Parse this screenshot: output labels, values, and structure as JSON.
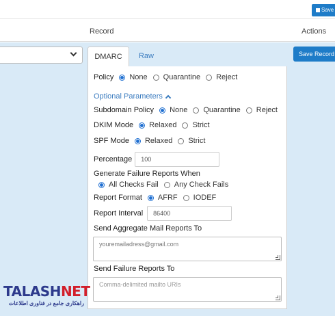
{
  "header": {
    "save_button_label": "Save"
  },
  "table": {
    "col_record": "Record",
    "col_actions": "Actions"
  },
  "tabs": {
    "dmarc": "DMARC",
    "raw": "Raw"
  },
  "save_record_label": "Save Record",
  "form": {
    "policy": {
      "label": "Policy",
      "options": [
        "None",
        "Quarantine",
        "Reject"
      ],
      "selected": "None"
    },
    "optional_parameters_label": "Optional Parameters",
    "subdomain_policy": {
      "label": "Subdomain Policy",
      "options": [
        "None",
        "Quarantine",
        "Reject"
      ],
      "selected": "None"
    },
    "dkim_mode": {
      "label": "DKIM Mode",
      "options": [
        "Relaxed",
        "Strict"
      ],
      "selected": "Relaxed"
    },
    "spf_mode": {
      "label": "SPF Mode",
      "options": [
        "Relaxed",
        "Strict"
      ],
      "selected": "Relaxed"
    },
    "percentage": {
      "label": "Percentage",
      "value": "100"
    },
    "failure_reports": {
      "label": "Generate Failure Reports When",
      "options": [
        "All Checks Fail",
        "Any Check Fails"
      ],
      "selected": "All Checks Fail"
    },
    "report_format": {
      "label": "Report Format",
      "options": [
        "AFRF",
        "IODEF"
      ],
      "selected": "AFRF"
    },
    "report_interval": {
      "label": "Report Interval",
      "value": "86400"
    },
    "aggregate_reports": {
      "label": "Send Aggregate Mail Reports To",
      "value": "youremailadress@gmail.com"
    },
    "failure_reports_to": {
      "label": "Send Failure Reports To",
      "placeholder": "Comma-delimited mailto URIs"
    }
  },
  "watermark": {
    "brand_part1": "TALASH",
    "brand_part2": "NET",
    "tagline": "راهکاری جامع در فناوری اطلاعات"
  },
  "colors": {
    "accent": "#1e7cc8",
    "link": "#3a7bbf",
    "row_background": "#d9eaf7"
  }
}
